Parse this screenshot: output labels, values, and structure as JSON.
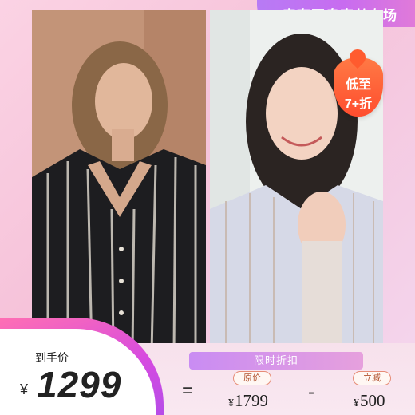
{
  "banner": {
    "title": "春奢夏帛真丝专场"
  },
  "badge": {
    "line1": "低至",
    "line2": "7+折"
  },
  "promo": {
    "limited_label": "限时折扣"
  },
  "final_price": {
    "label": "到手价",
    "currency": "¥",
    "amount": "1299"
  },
  "equation": {
    "equals": "=",
    "minus": "-"
  },
  "original": {
    "label": "原价",
    "currency": "¥",
    "amount": "1799"
  },
  "reduction": {
    "label": "立减",
    "currency": "¥",
    "amount": "500"
  },
  "colors": {
    "accent": "#c86cf0",
    "badge": "#ff5b2e",
    "pink": "#ff6fb3"
  }
}
